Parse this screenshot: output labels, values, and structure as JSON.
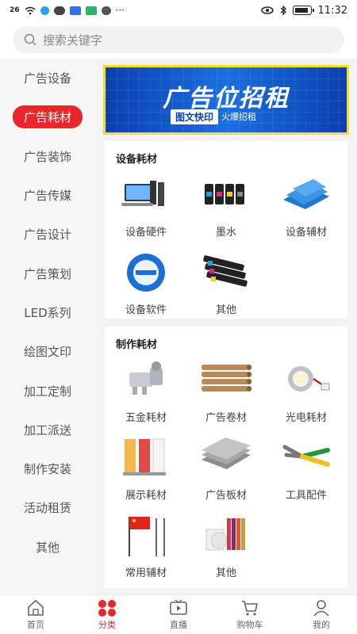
{
  "status_bar": {
    "time": "11:32",
    "network": "26",
    "icons": [
      "signal-icon",
      "wifi-icon",
      "qq-icon",
      "wechat-icon",
      "app-icon",
      "app-icon",
      "message-icon",
      "more-icon",
      "eye-icon",
      "bluetooth-icon",
      "battery-icon"
    ]
  },
  "search": {
    "placeholder": "搜索关键字"
  },
  "sidebar": {
    "items": [
      {
        "label": "广告设备"
      },
      {
        "label": "广告耗材",
        "active": true
      },
      {
        "label": "广告装饰"
      },
      {
        "label": "广告传媒"
      },
      {
        "label": "广告设计"
      },
      {
        "label": "广告策划"
      },
      {
        "label": "LED系列"
      },
      {
        "label": "绘图文印"
      },
      {
        "label": "加工定制"
      },
      {
        "label": "加工派送"
      },
      {
        "label": "制作安装"
      },
      {
        "label": "活动租赁"
      },
      {
        "label": "其他"
      }
    ]
  },
  "banner": {
    "headline": "广告位招租",
    "tag": "图文快印",
    "sub": "火爆招租",
    "border_color": "#f0e02a"
  },
  "sections": [
    {
      "title": "设备耗材",
      "items": [
        {
          "label": "设备硬件",
          "icon": "computer-hardware-icon"
        },
        {
          "label": "墨水",
          "icon": "ink-bottles-icon"
        },
        {
          "label": "设备辅材",
          "icon": "blue-boards-icon"
        },
        {
          "label": "设备软件",
          "icon": "ie-software-icon"
        },
        {
          "label": "其他",
          "icon": "toner-cartridges-icon"
        }
      ]
    },
    {
      "title": "制作耗材",
      "items": [
        {
          "label": "五金耗材",
          "icon": "hardware-fitting-icon"
        },
        {
          "label": "广告卷材",
          "icon": "paper-rolls-icon"
        },
        {
          "label": "光电耗材",
          "icon": "led-light-icon"
        },
        {
          "label": "展示耗材",
          "icon": "rollup-banners-icon"
        },
        {
          "label": "广告板材",
          "icon": "gray-boards-icon"
        },
        {
          "label": "工具配件",
          "icon": "pliers-icon"
        },
        {
          "label": "常用辅材",
          "icon": "flag-poles-icon"
        },
        {
          "label": "其他",
          "icon": "misc-materials-icon"
        }
      ]
    }
  ],
  "bottom_nav": {
    "items": [
      {
        "label": "首页",
        "icon": "home-icon"
      },
      {
        "label": "分类",
        "icon": "category-icon",
        "active": true
      },
      {
        "label": "直播",
        "icon": "live-tv-icon"
      },
      {
        "label": "购物车",
        "icon": "cart-icon"
      },
      {
        "label": "我的",
        "icon": "user-icon"
      }
    ]
  },
  "colors": {
    "accent": "#e8262c",
    "sidebar_bg": "#f7f7f7"
  }
}
